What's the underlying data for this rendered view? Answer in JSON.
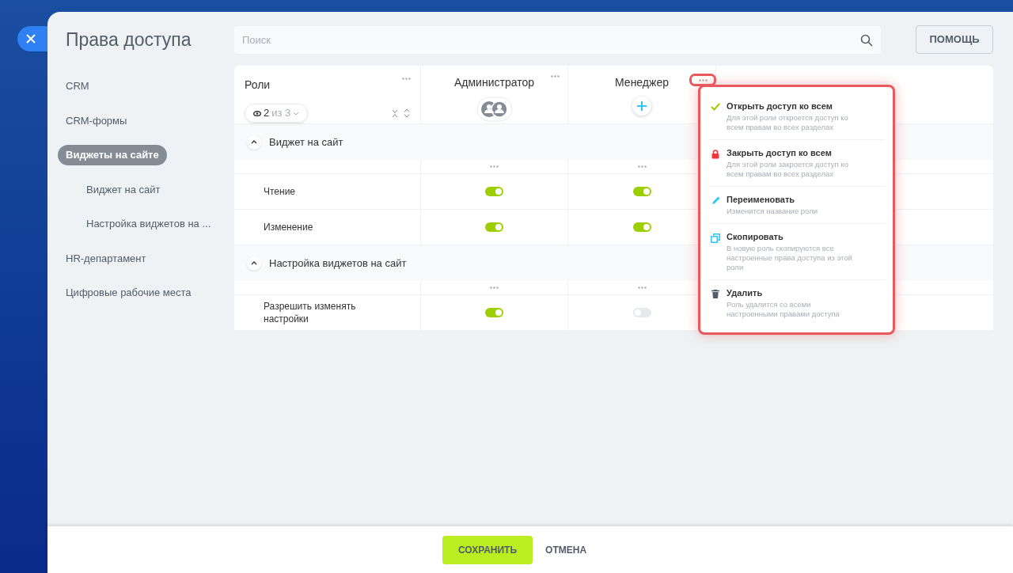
{
  "title": "Права доступа",
  "search": {
    "placeholder": "Поиск"
  },
  "help_button": "ПОМОЩЬ",
  "sidebar": {
    "items": [
      {
        "label": "CRM",
        "selected": false
      },
      {
        "label": "CRM-формы",
        "selected": false
      },
      {
        "label": "Виджеты на сайте",
        "selected": true,
        "children": [
          {
            "label": "Виджет на сайт",
            "selected": false
          },
          {
            "label": "Настройка виджетов на ...",
            "selected": false
          }
        ]
      },
      {
        "label": "HR-департамент",
        "selected": false
      },
      {
        "label": "Цифровые рабочие места",
        "selected": false
      }
    ]
  },
  "table": {
    "roles_label": "Роли",
    "visible_count": "2",
    "total_label": "из 3",
    "columns": [
      {
        "name": "Администратор",
        "kind": "avatars",
        "menu_open": false
      },
      {
        "name": "Менеджер",
        "kind": "add",
        "menu_open": true
      }
    ],
    "sections": [
      {
        "title": "Виджет на сайт",
        "expanded": true,
        "rows": [
          {
            "label": "Чтение",
            "values": [
              true,
              true
            ]
          },
          {
            "label": "Изменение",
            "values": [
              true,
              true
            ]
          }
        ]
      },
      {
        "title": "Настройка виджетов на сайт",
        "expanded": true,
        "rows": [
          {
            "label": "Разрешить изменять настройки",
            "values": [
              true,
              false
            ]
          }
        ]
      }
    ]
  },
  "menu": [
    {
      "kind": "check",
      "title": "Открыть доступ ко всем",
      "description": "Для этой роли откроется доступ ко всем правам во всех разделах"
    },
    {
      "kind": "lock",
      "title": "Закрыть доступ ко всем",
      "description": "Для этой роли закроется доступ ко всем правам во всех разделах"
    },
    {
      "kind": "pencil",
      "title": "Переименовать",
      "description": "Изменится название роли"
    },
    {
      "kind": "copy",
      "title": "Скопировать",
      "description": "В новую роль скопируются все настроенные права доступа из этой роли"
    },
    {
      "kind": "trash",
      "title": "Удалить",
      "description": "Роль удалится со всеми настроенными правами доступа"
    }
  ],
  "footer": {
    "save": "СОХРАНИТЬ",
    "cancel": "ОТМЕНА"
  }
}
